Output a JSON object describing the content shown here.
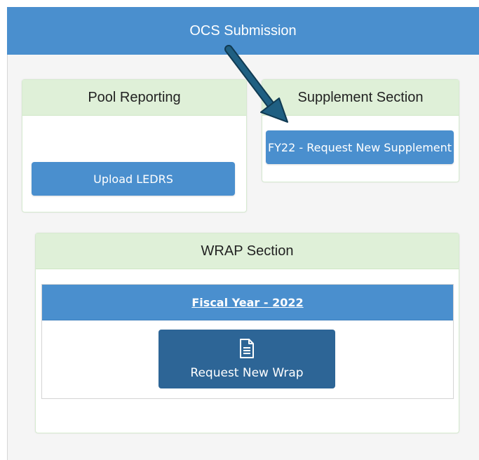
{
  "header": {
    "title": "OCS Submission"
  },
  "pool_reporting": {
    "title": "Pool Reporting",
    "upload_label": "Upload LEDRS"
  },
  "supplement": {
    "title": "Supplement Section",
    "request_label": "FY22 - Request New Supplement"
  },
  "wrap": {
    "title": "WRAP Section",
    "fiscal_year_link": "Fiscal Year - 2022",
    "request_label": "Request New Wrap",
    "request_icon": "document-icon"
  },
  "colors": {
    "primary": "#4a8fce",
    "dark_primary": "#2d6596",
    "panel_header": "#dff0d8",
    "arrow": "#1f5f82"
  }
}
